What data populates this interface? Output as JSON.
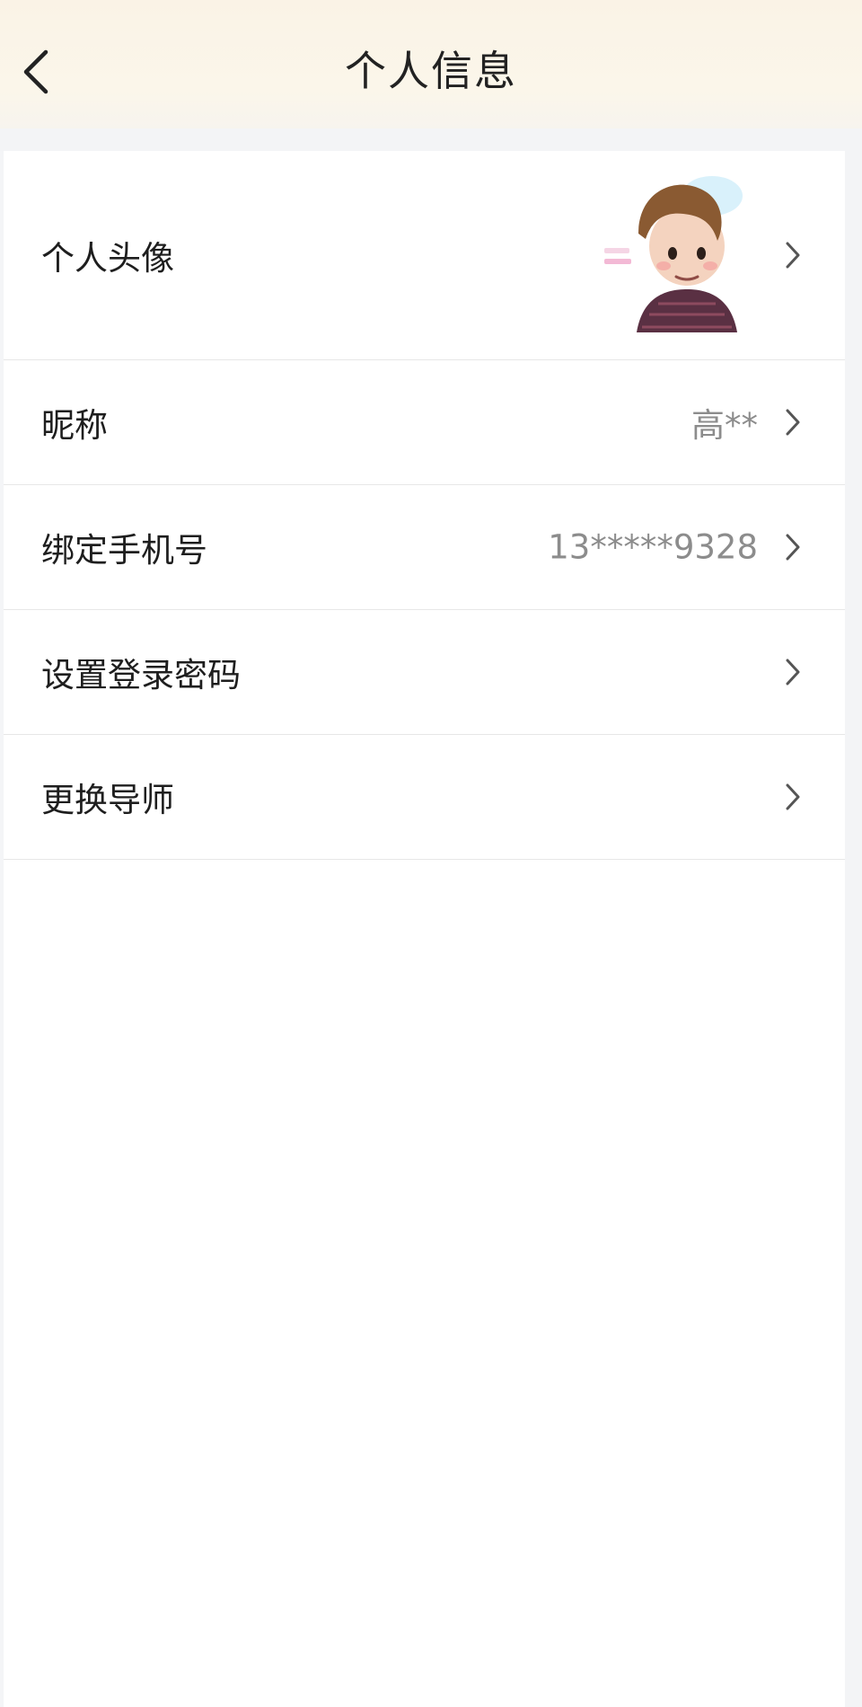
{
  "header": {
    "title": "个人信息",
    "back_icon": "chevron-left-icon"
  },
  "rows": [
    {
      "label": "个人头像",
      "value": "",
      "type": "avatar"
    },
    {
      "label": "昵称",
      "value": "高**",
      "type": "text"
    },
    {
      "label": "绑定手机号",
      "value": "13*****9328",
      "type": "text"
    },
    {
      "label": "设置登录密码",
      "value": "",
      "type": "link"
    },
    {
      "label": "更换导师",
      "value": "",
      "type": "link"
    }
  ],
  "colors": {
    "header_bg": "#faf3e6",
    "page_bg": "#f4f5f7",
    "card_bg": "#ffffff",
    "text_primary": "#1e1e1e",
    "text_secondary": "#8c8c8c",
    "divider": "#e7e7e7"
  }
}
